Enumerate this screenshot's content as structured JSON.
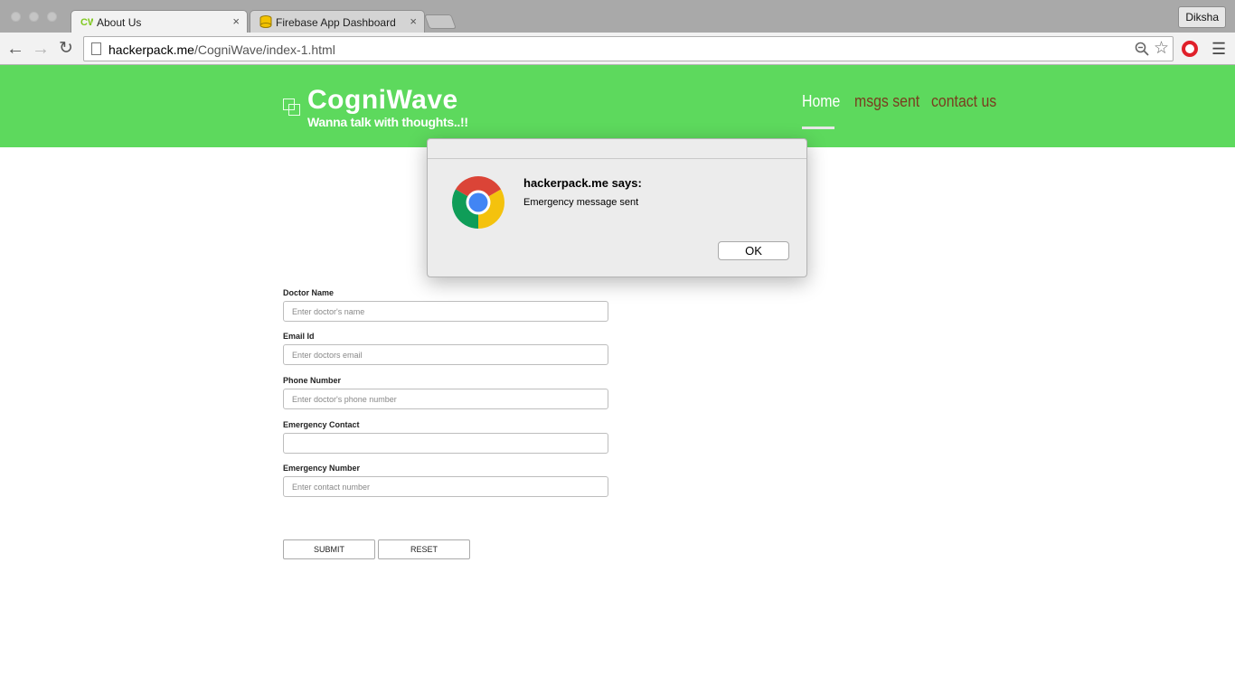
{
  "browser": {
    "tabs": [
      {
        "title": "About Us",
        "icon": "cw-favicon",
        "active": true
      },
      {
        "title": "Firebase App Dashboard",
        "icon": "firebase-database-icon",
        "active": false
      }
    ],
    "tab_close_glyph": "×",
    "profile_name": "Diksha",
    "url_host": "hackerpack.me",
    "url_path": "/CogniWave/index-1.html"
  },
  "site": {
    "brand_name": "CogniWave",
    "tagline": "Wanna talk with thoughts..!!",
    "nav": [
      {
        "label": "Home",
        "active": true
      },
      {
        "label": "msgs sent",
        "active": false
      },
      {
        "label": "contact us",
        "active": false
      }
    ],
    "accent_color": "#5dd95d"
  },
  "form": {
    "fields": [
      {
        "label": "Doctor Name",
        "placeholder": "Enter doctor's name",
        "value": ""
      },
      {
        "label": "Email Id",
        "placeholder": "Enter doctors email",
        "value": ""
      },
      {
        "label": "Phone Number",
        "placeholder": "Enter doctor's phone number",
        "value": ""
      },
      {
        "label": "Emergency Contact",
        "placeholder": "",
        "value": ""
      },
      {
        "label": "Emergency Number",
        "placeholder": "Enter contact number",
        "value": ""
      }
    ],
    "submit_label": "SUBMIT",
    "reset_label": "RESET"
  },
  "dialog": {
    "title": "hackerpack.me says:",
    "message": "Emergency message sent",
    "ok_label": "OK",
    "icon": "chrome-logo-icon"
  }
}
